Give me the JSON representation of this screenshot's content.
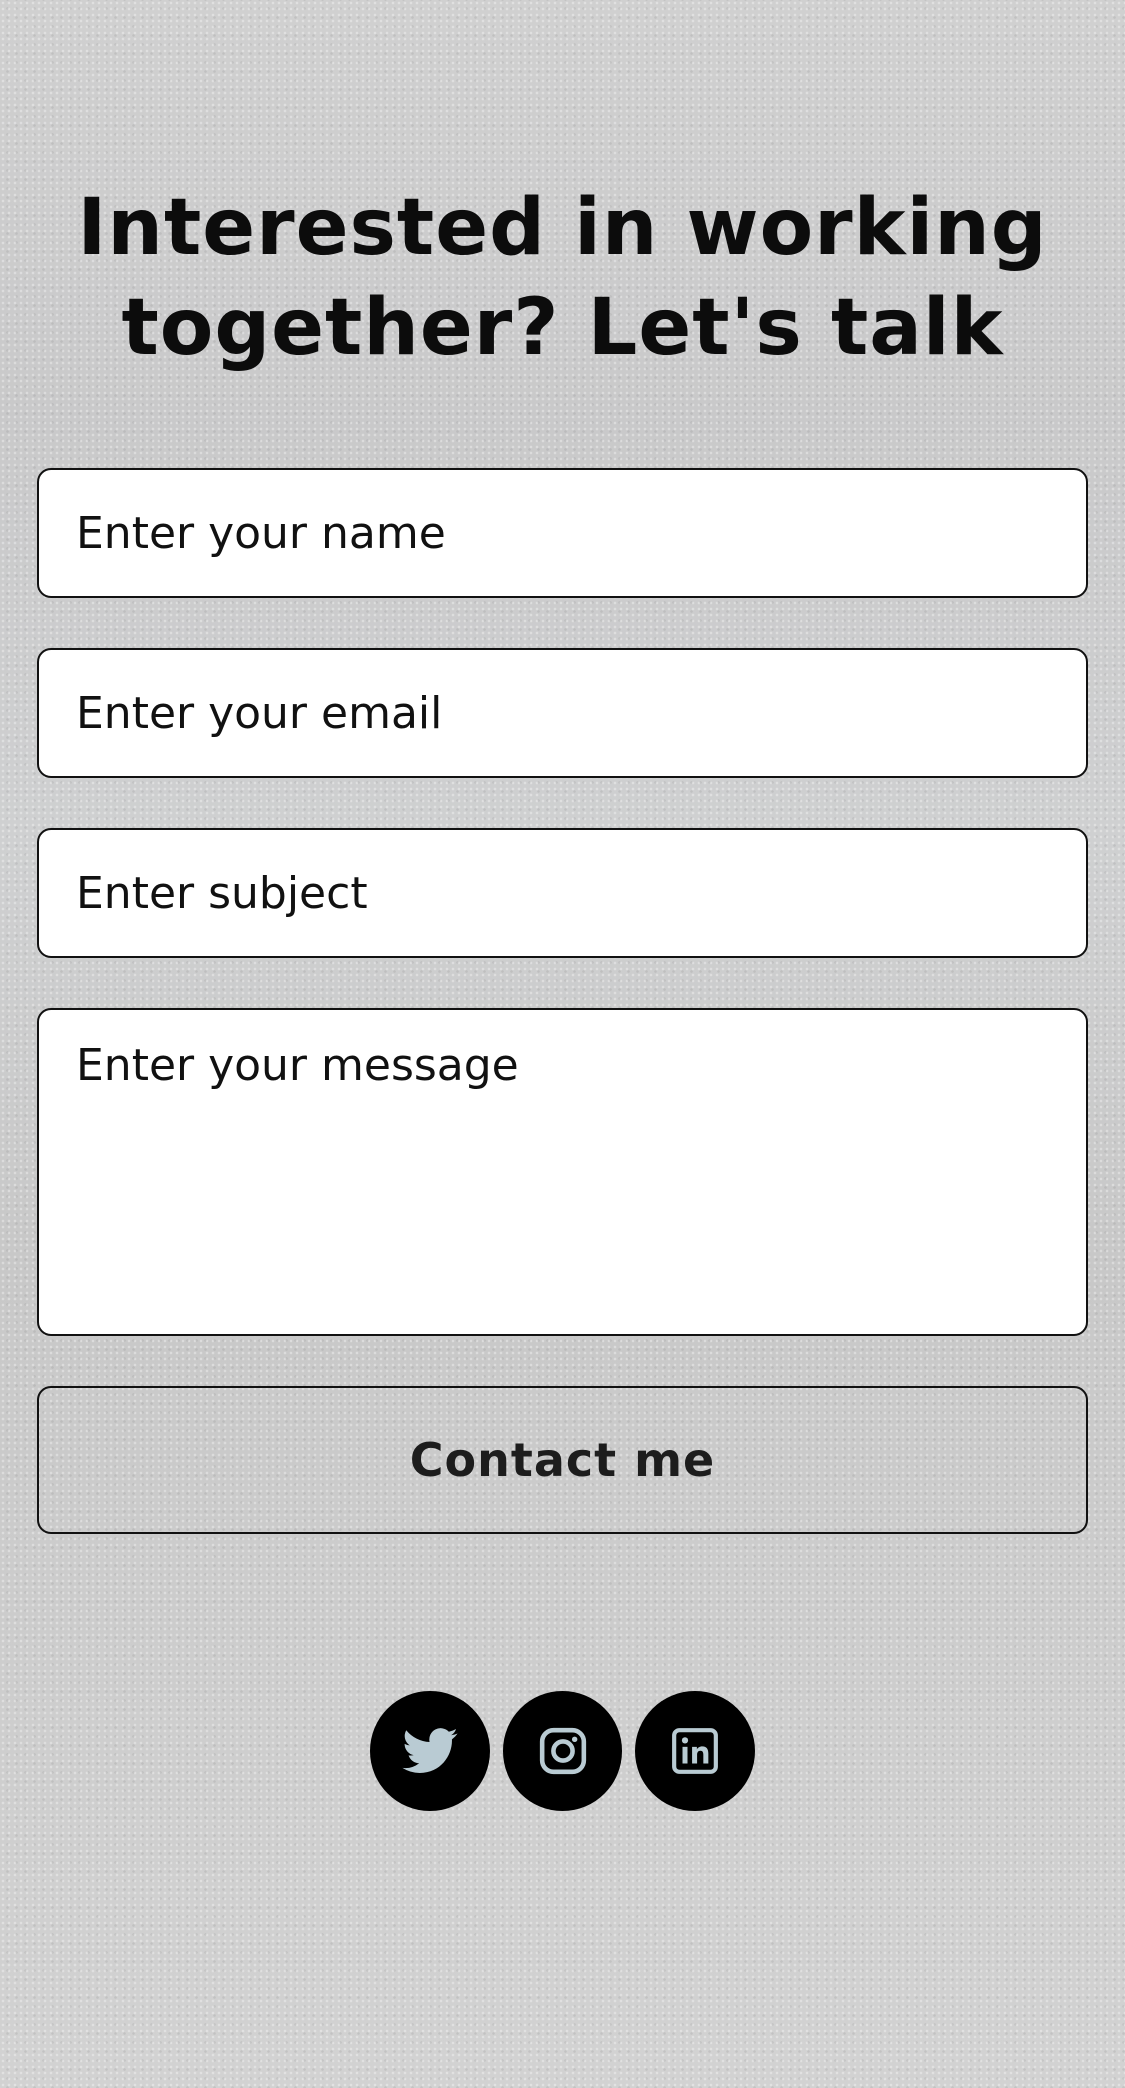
{
  "headline": {
    "line1": "Interested in working",
    "line2": "together? Let's talk"
  },
  "form": {
    "name_placeholder": "Enter your name",
    "email_placeholder": "Enter your email",
    "subject_placeholder": "Enter subject",
    "message_placeholder": "Enter your message",
    "submit_label": "Contact me"
  },
  "social": [
    {
      "icon": "twitter-icon"
    },
    {
      "icon": "instagram-icon"
    },
    {
      "icon": "linkedin-icon"
    }
  ],
  "colors": {
    "text": "#111111",
    "field_background": "#ffffff",
    "icon_circle": "#000000",
    "icon_glyph": "#b9cbd3"
  }
}
